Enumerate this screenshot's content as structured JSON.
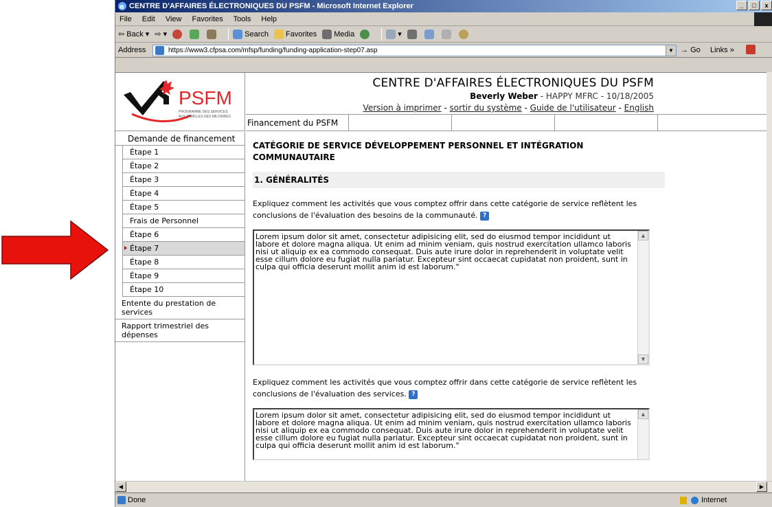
{
  "window": {
    "title": "CENTRE D'AFFAIRES ÉLECTRONIQUES DU PSFM - Microsoft Internet Explorer",
    "buttons": [
      "_",
      "□",
      "x"
    ]
  },
  "menu": [
    "File",
    "Edit",
    "View",
    "Favorites",
    "Tools",
    "Help"
  ],
  "toolbar": {
    "back": "Back",
    "search": "Search",
    "favorites": "Favorites",
    "media": "Media"
  },
  "address": {
    "label": "Address",
    "url": "https://www3.cfpsa.com/mfsp/funding/funding-application-step07.asp",
    "go": "Go",
    "links": "Links"
  },
  "logo": {
    "brand": "PSFM",
    "tagline_1": "PROGRAMME DES SERVICES",
    "tagline_2": "AUX FAMILLES DES MILITAIRES",
    "colors": {
      "red": "#e3262b",
      "black": "#111111",
      "grey": "#7a7a7a"
    }
  },
  "header": {
    "site_title": "CENTRE D'AFFAIRES ÉLECTRONIQUES DU PSFM",
    "user_name": "Beverly Weber",
    "user_meta": " - HAPPY MFRC - 10/18/2005",
    "link_print": "Version à imprimer",
    "link_logout": "sortir du système",
    "link_guide": "Guide de l'utilisateur",
    "link_english": "English",
    "sep": " - "
  },
  "tabs": [
    "Financement du PSFM",
    "",
    "",
    ""
  ],
  "nav": {
    "head": "Demande de financement",
    "steps": [
      "Étape 1",
      "Étape 2",
      "Étape 3",
      "Étape 4",
      "Étape 5",
      "Frais de Personnel",
      "Étape 6",
      "Étape 7",
      "Étape 8",
      "Étape 9",
      "Étape 10"
    ],
    "active_step": "Étape 7",
    "blocks": [
      "Entente du prestation de services",
      "Rapport trimestriel des dépenses"
    ]
  },
  "main": {
    "category_title": "CATÉGORIE DE SERVICE DÉVELOPPEMENT PERSONNEL ET INTÉGRATION COMMUNAUTAIRE",
    "section_title": "1. GÉNÉRALITÉS",
    "q1": "Expliquez comment les activités que vous comptez offrir dans cette catégorie de service reflètent les conclusions de l'évaluation des besoins de la communauté.",
    "q2": "Expliquez comment les activités que vous comptez offrir dans cette catégorie de service reflètent les conclusions de l'évaluation des services.",
    "lorem": "Lorem ipsum dolor sit amet, consectetur adipisicing elit, sed do eiusmod tempor incididunt ut labore et dolore magna aliqua. Ut enim ad minim veniam, quis nostrud exercitation ullamco laboris nisi ut aliquip ex ea commodo consequat. Duis aute irure dolor in reprehenderit in voluptate velit esse cillum dolore eu fugiat nulla pariatur. Excepteur sint occaecat cupidatat non proident, sunt in culpa qui officia deserunt mollit anim id est laborum.\"",
    "help_glyph": "?"
  },
  "status": {
    "text": "Done",
    "zone": "Internet"
  },
  "annotation": {
    "arrow_color": "#e8120c"
  }
}
